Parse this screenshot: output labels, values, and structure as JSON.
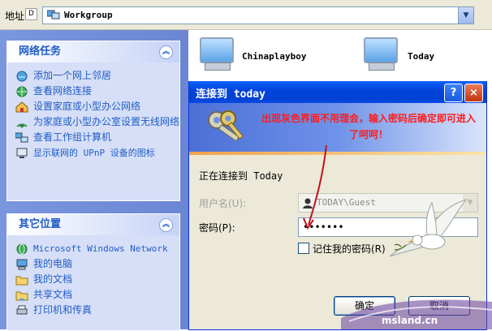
{
  "address_bar": {
    "label": "地址",
    "hotkey": "D",
    "value": "Workgroup"
  },
  "left_pane": {
    "network_tasks": {
      "title": "网络任务",
      "items": [
        {
          "label": "添加一个网上邻居",
          "icon": "network-place-icon"
        },
        {
          "label": "查看网络连接",
          "icon": "network-connections-icon"
        },
        {
          "label": "设置家庭或小型办公网络",
          "icon": "home-network-icon"
        },
        {
          "label": "为家庭或小型办公室设置无线网络",
          "icon": "wireless-icon"
        },
        {
          "label": "查看工作组计算机",
          "icon": "workgroup-computers-icon"
        },
        {
          "label": "显示联网的 UPnP 设备的图标",
          "icon": "upnp-icon"
        }
      ]
    },
    "other_places": {
      "title": "其它位置",
      "items": [
        {
          "label": "Microsoft Windows Network",
          "icon": "globe-icon"
        },
        {
          "label": "我的电脑",
          "icon": "my-computer-icon"
        },
        {
          "label": "我的文档",
          "icon": "my-documents-icon"
        },
        {
          "label": "共享文档",
          "icon": "shared-documents-icon"
        },
        {
          "label": "打印机和传真",
          "icon": "printer-icon"
        }
      ]
    }
  },
  "computers": [
    {
      "name": "Chinaplayboy"
    },
    {
      "name": "Today"
    }
  ],
  "dialog": {
    "title": "连接到 today",
    "help_label": "?",
    "close_label": "×",
    "note": "出现灰色界面不用理会，输入密码后确定即可进入了呵呵！",
    "connecting_text": "正在连接到 Today",
    "username_label": "用户名(U):",
    "username_value": "TODAY\\Guest",
    "password_label": "密码(P):",
    "password_value": "•••••••",
    "remember_label": "记住我的密码(R)",
    "ok_label": "确定",
    "cancel_label": "取消"
  },
  "watermark": {
    "text": "msland.cn"
  },
  "colors": {
    "title_blue": "#0343d9",
    "task_pane": "#6b86d3",
    "note_red": "#ff1c1c"
  }
}
